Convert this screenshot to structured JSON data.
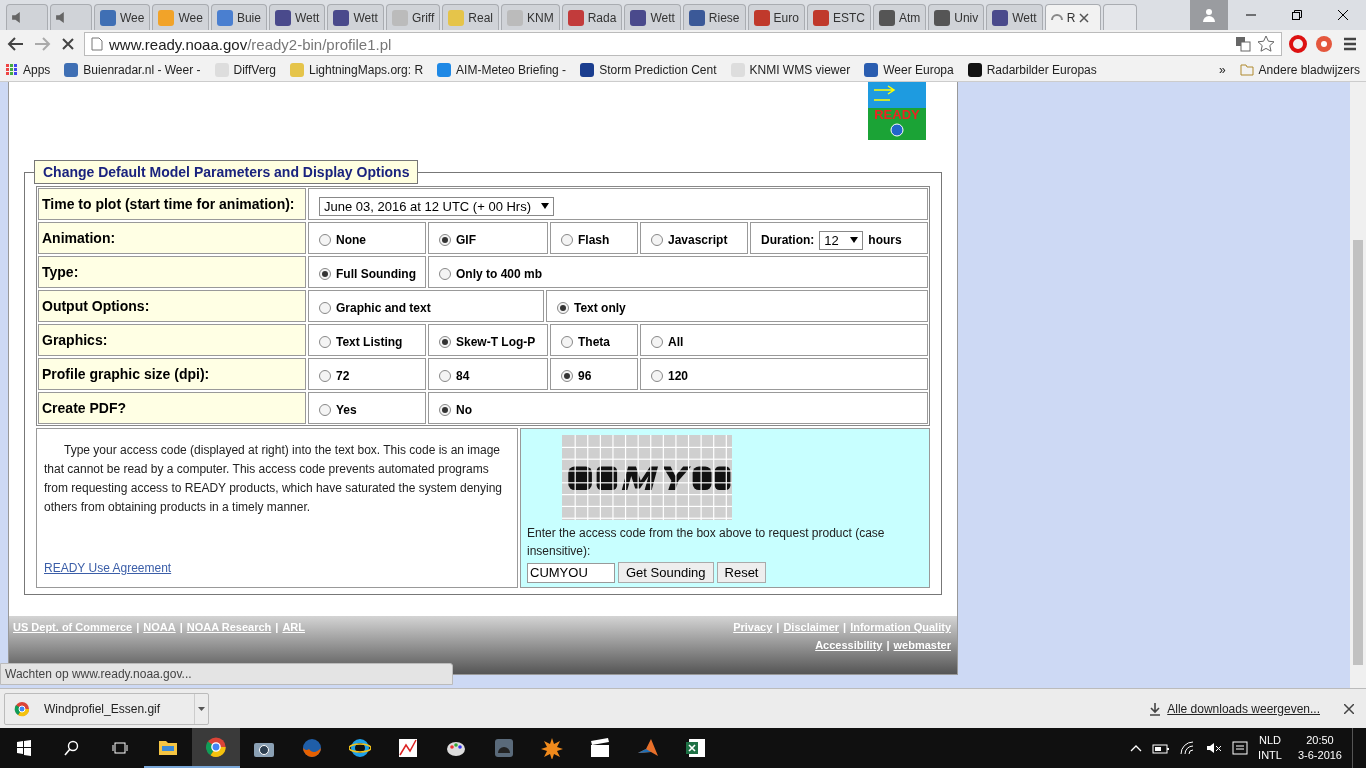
{
  "browser": {
    "tabs": [
      {
        "kind": "audio",
        "selected": false
      },
      {
        "kind": "audio",
        "selected": false
      },
      {
        "kind": "page",
        "title": "Wee",
        "selected": false
      },
      {
        "kind": "page",
        "title": "Wee",
        "selected": false
      },
      {
        "kind": "page",
        "title": "Buie",
        "selected": false
      },
      {
        "kind": "page",
        "title": "Wett",
        "selected": false
      },
      {
        "kind": "page",
        "title": "Wett",
        "selected": false
      },
      {
        "kind": "page",
        "title": "Griff",
        "selected": false
      },
      {
        "kind": "page",
        "title": "Real",
        "selected": false
      },
      {
        "kind": "page",
        "title": "KNM",
        "selected": false
      },
      {
        "kind": "page",
        "title": "Rada",
        "selected": false
      },
      {
        "kind": "page",
        "title": "Wett",
        "selected": false
      },
      {
        "kind": "page",
        "title": "Riese",
        "selected": false
      },
      {
        "kind": "page",
        "title": "Euro",
        "selected": false
      },
      {
        "kind": "page",
        "title": "ESTC",
        "selected": false
      },
      {
        "kind": "page",
        "title": "Atm",
        "selected": false
      },
      {
        "kind": "page",
        "title": "Univ",
        "selected": false
      },
      {
        "kind": "page",
        "title": "Wett",
        "selected": false
      },
      {
        "kind": "loading",
        "title": "R",
        "selected": true
      }
    ],
    "address": {
      "host": "www.ready.noaa.gov",
      "path": "/ready2-bin/profile1.pl"
    },
    "bookmarks": [
      "Apps",
      "Buienradar.nl - Weer -",
      "DiffVerg",
      "LightningMaps.org: R",
      "AIM-Meteo Briefing -",
      "Storm Prediction Cent",
      "KNMI WMS viewer",
      "Weer Europa",
      "Radarbilder Europas"
    ],
    "bookmarks_more": "»",
    "other_bookmarks": "Andere bladwijzers"
  },
  "page": {
    "logo_text": "READY",
    "form": {
      "legend": "Change Default Model Parameters and Display Options",
      "rows": [
        {
          "kind": "select",
          "label": "Time to plot (start time for animation):",
          "value": "June 03, 2016 at 12 UTC (+ 00 Hrs)"
        },
        {
          "kind": "radios",
          "label": "Animation:",
          "options": [
            {
              "label": "None",
              "selected": false
            },
            {
              "label": "GIF",
              "selected": true
            },
            {
              "label": "Flash",
              "selected": false
            },
            {
              "label": "Javascript",
              "selected": false
            }
          ],
          "duration": {
            "label": "Duration:",
            "value": "12",
            "unit": "hours"
          }
        },
        {
          "kind": "radios",
          "label": "Type:",
          "options": [
            {
              "label": "Full Sounding",
              "selected": true
            },
            {
              "label": "Only to 400 mb",
              "selected": false
            }
          ]
        },
        {
          "kind": "radios",
          "label": "Output Options:",
          "options": [
            {
              "label": "Graphic and text",
              "selected": false
            },
            {
              "label": "Text only",
              "selected": true
            }
          ]
        },
        {
          "kind": "radios",
          "label": "Graphics:",
          "options": [
            {
              "label": "Text Listing",
              "selected": false
            },
            {
              "label": "Skew-T Log-P",
              "selected": true
            },
            {
              "label": "Theta",
              "selected": false
            },
            {
              "label": "All",
              "selected": false
            }
          ]
        },
        {
          "kind": "radios",
          "label": "Profile graphic size (dpi):",
          "options": [
            {
              "label": "72",
              "selected": false
            },
            {
              "label": "84",
              "selected": false
            },
            {
              "label": "96",
              "selected": true
            },
            {
              "label": "120",
              "selected": false
            }
          ]
        },
        {
          "kind": "radios",
          "label": "Create PDF?",
          "options": [
            {
              "label": "Yes",
              "selected": false
            },
            {
              "label": "No",
              "selected": true
            }
          ]
        }
      ]
    },
    "notice": "Type your access code (displayed at right) into the text box. This code is an image that cannot be read by a computer. This access code prevents automated programs from requesting access to READY products, which have saturated the system denying others from obtaining products in a timely manner.",
    "agreement_link": "READY Use Agreement",
    "captcha": {
      "kind": "picture",
      "prompt": "Enter the access code from the box above to request product (case insensitive):",
      "value": "CUMYOU",
      "buttons": [
        "Get Sounding",
        "Reset"
      ]
    },
    "footer": {
      "separator": "|",
      "left_links": [
        "US Dept. of Commerce",
        "NOAA",
        "NOAA Research",
        "ARL"
      ],
      "right_links": [
        "Privacy",
        "Disclaimer",
        "Information Quality"
      ],
      "right_links_2": [
        "Accessibility",
        "webmaster"
      ]
    }
  },
  "status": "Wachten op www.ready.noaa.gov...",
  "downloads": {
    "file": "Windprofiel_Essen.gif",
    "show_all": "Alle downloads weergeven..."
  },
  "taskbar": {
    "language": "NLD",
    "layout": "INTL",
    "time": "20:50",
    "date": "3-6-2016"
  }
}
